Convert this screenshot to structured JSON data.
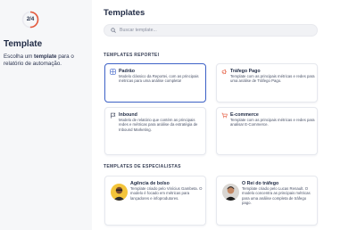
{
  "wizard": {
    "step": "2/4",
    "title": "Template",
    "desc_prefix": "Escolha um ",
    "desc_bold": "template",
    "desc_suffix": " para o relatório de automação.",
    "accent": "#e4583b"
  },
  "main": {
    "title": "Templates",
    "search_placeholder": "Buscar template...",
    "section_reportei": "TEMPLATES REPORTEI",
    "section_especialistas": "TEMPLATES DE ESPECIALISTAS"
  },
  "templates": [
    {
      "title": "Padrão",
      "desc": "Modelo clássico da Reportei, com as principais métricas para uma análise completa!",
      "icon": "grid-chart-icon",
      "icon_color": "#3f63c8",
      "selected": true
    },
    {
      "title": "Tráfego Pago",
      "desc": "Template com as principais métricas e redes para uma análise de Tráfego Pago.",
      "icon": "megaphone-icon",
      "icon_color": "#e4583b",
      "selected": false
    },
    {
      "title": "Inbound",
      "desc": "Modelo de relatório que contém as principais redes e métricas para análise da estratégia de Inbound Marketing.",
      "icon": "flag-icon",
      "icon_color": "#3a4258",
      "selected": false
    },
    {
      "title": "E-commerce",
      "desc": "Template com as principais métricas e redes para analisar E-Commerce.",
      "icon": "cart-icon",
      "icon_color": "#e4583b",
      "selected": false
    }
  ],
  "specialists": [
    {
      "title": "Agência de bolso",
      "desc": "Template criado pelo Vinícius Gambeta. O modelo é focado em métricas para lançadores e infoprodutores."
    },
    {
      "title": "O Rei do tráfego",
      "desc": "Template criado pelo Lucas Renault. O modelo concentra as principais métricas para uma análise completa de tráfego pago."
    }
  ]
}
